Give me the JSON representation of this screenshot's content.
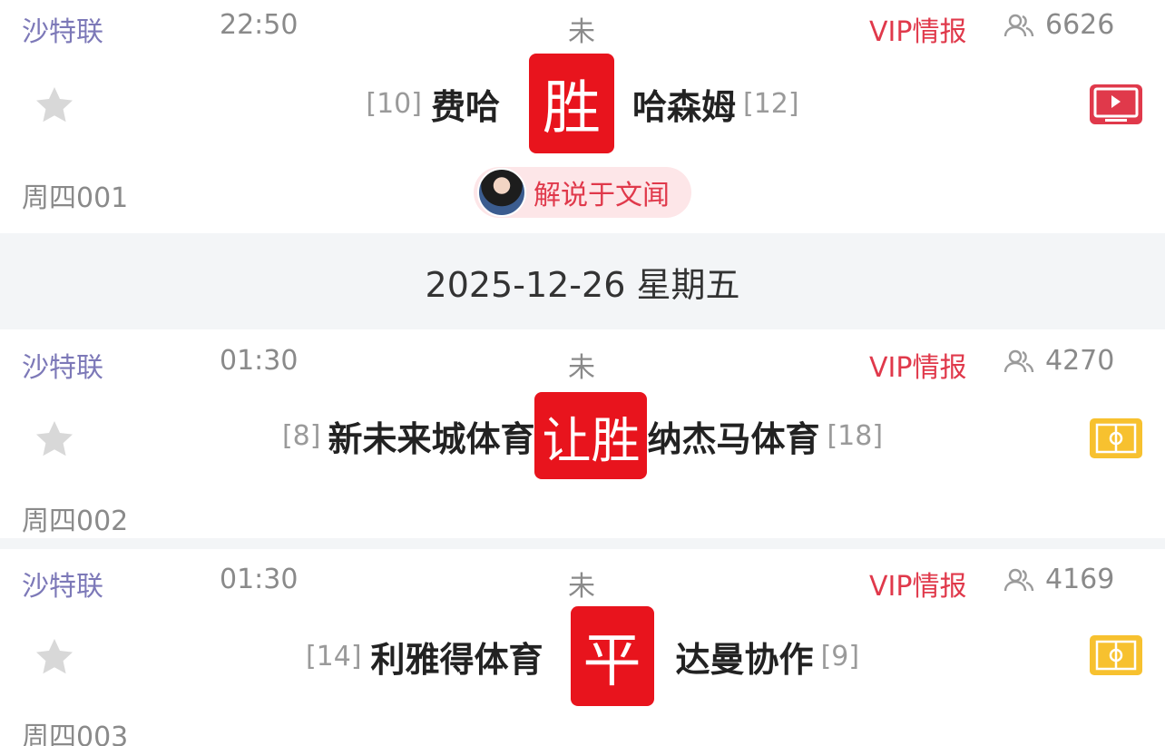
{
  "matches": [
    {
      "league": "沙特联",
      "time": "22:50",
      "status": "未",
      "vip_label": "VIP情报",
      "watchers": "6626",
      "home_rank": "[10]",
      "home_team": "费哈",
      "result_badge": "胜",
      "away_team": "哈森姆",
      "away_rank": "[12]",
      "code": "周四001",
      "media_icon": "tv-play-icon",
      "commentator_label": "解说于文闻"
    },
    {
      "league": "沙特联",
      "time": "01:30",
      "status": "未",
      "vip_label": "VIP情报",
      "watchers": "4270",
      "home_rank": "[8]",
      "home_team": "新未来城体育",
      "result_badge": "让胜",
      "away_team": "纳杰马体育",
      "away_rank": "[18]",
      "code": "周四002",
      "media_icon": "pitch-icon"
    },
    {
      "league": "沙特联",
      "time": "01:30",
      "status": "未",
      "vip_label": "VIP情报",
      "watchers": "4169",
      "home_rank": "[14]",
      "home_team": "利雅得体育",
      "result_badge": "平",
      "away_team": "达曼协作",
      "away_rank": "[9]",
      "code": "周四003",
      "media_icon": "pitch-icon"
    }
  ],
  "date_header": "2025-12-26 星期五",
  "colors": {
    "league": "#7d79b8",
    "vip": "#e0394b",
    "badge": "#e8141d",
    "pitch_icon": "#f7c12f",
    "tv_icon": "#e0394b"
  }
}
